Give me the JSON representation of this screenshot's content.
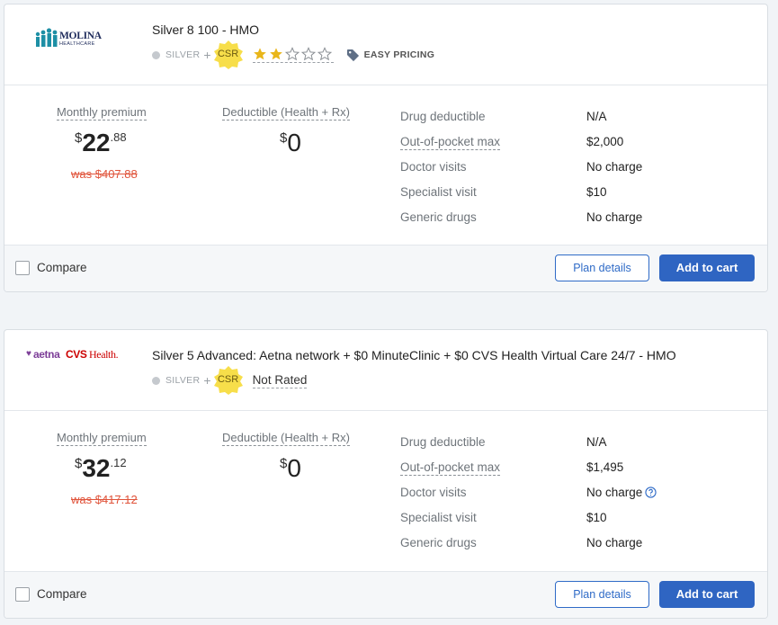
{
  "plans": [
    {
      "carrier": "Molina Healthcare",
      "logo_text_main": "MOLINA",
      "logo_text_sub": "HEALTHCARE",
      "plan_name": "Silver 8 100 - HMO",
      "metal_label": "SILVER",
      "plus": "+",
      "csr_label": "CSR",
      "rating": 2,
      "rating_max": 5,
      "feature_tag": "EASY PRICING",
      "monthly_premium_label": "Monthly premium",
      "premium_currency": "$",
      "premium_dollars": "22",
      "premium_cents": ".88",
      "was_price": "was $407.88",
      "deductible_label": "Deductible (Health + Rx)",
      "deductible_currency": "$",
      "deductible_value": "0",
      "details": [
        {
          "label": "Drug deductible",
          "value": "N/A"
        },
        {
          "label": "Out-of-pocket max",
          "value": "$2,000"
        },
        {
          "label": "Doctor visits",
          "value": "No charge"
        },
        {
          "label": "Specialist visit",
          "value": "$10"
        },
        {
          "label": "Generic drugs",
          "value": "No charge"
        }
      ],
      "compare_label": "Compare",
      "plan_details_label": "Plan details",
      "add_to_cart_label": "Add to cart"
    },
    {
      "carrier": "Aetna CVS Health",
      "logo_text_a": "aetna",
      "logo_text_b": "CVS",
      "logo_text_c": "Health.",
      "plan_name": "Silver 5 Advanced: Aetna network + $0 MinuteClinic + $0 CVS Health Virtual Care 24/7 - HMO",
      "metal_label": "SILVER",
      "plus": "+",
      "csr_label": "CSR",
      "rating_text": "Not Rated",
      "monthly_premium_label": "Monthly premium",
      "premium_currency": "$",
      "premium_dollars": "32",
      "premium_cents": ".12",
      "was_price": "was $417.12",
      "deductible_label": "Deductible (Health + Rx)",
      "deductible_currency": "$",
      "deductible_value": "0",
      "details": [
        {
          "label": "Drug deductible",
          "value": "N/A"
        },
        {
          "label": "Out-of-pocket max",
          "value": "$1,495"
        },
        {
          "label": "Doctor visits",
          "value": "No charge"
        },
        {
          "label": "Specialist visit",
          "value": "$10"
        },
        {
          "label": "Generic drugs",
          "value": "No charge"
        }
      ],
      "compare_label": "Compare",
      "plan_details_label": "Plan details",
      "add_to_cart_label": "Add to cart"
    }
  ],
  "colors": {
    "primary_blue": "#2f65c2",
    "was_red": "#e0533a",
    "star_gold": "#e9b61a",
    "csr_yellow": "#f7de4a",
    "molina_teal": "#1d8fa5",
    "aetna_purple": "#7d3f98",
    "cvs_red": "#cc0000"
  },
  "icons": {
    "metal": "silver-dot-icon",
    "csr": "csr-badge-icon",
    "star": "star-icon",
    "tag": "price-tag-icon",
    "help": "question-circle-icon",
    "checkbox": "checkbox-icon"
  }
}
